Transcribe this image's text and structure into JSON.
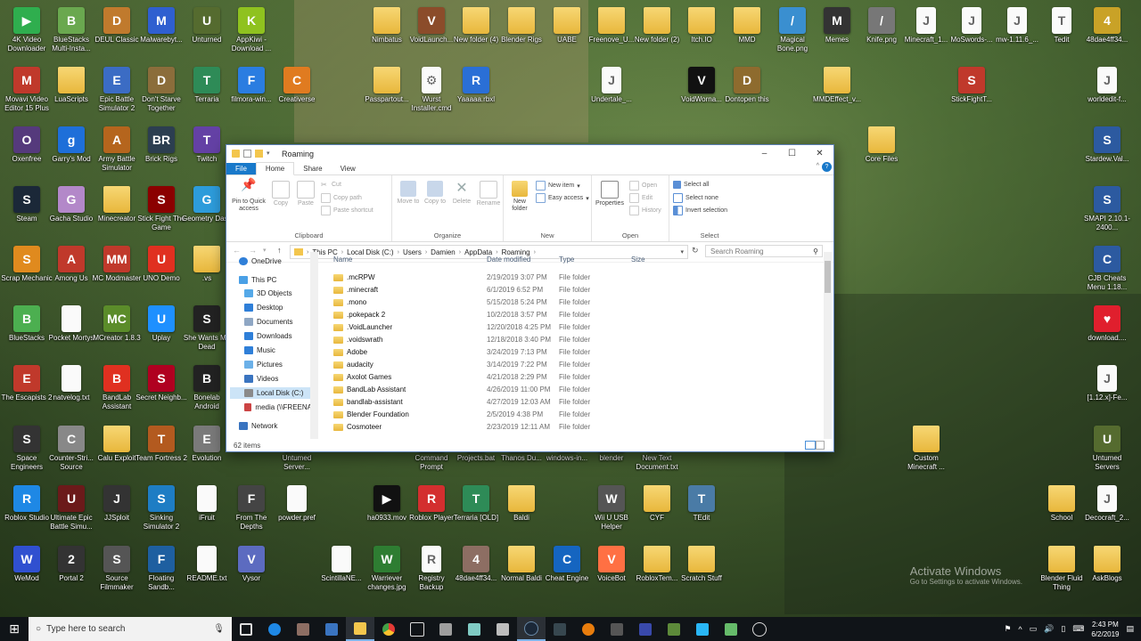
{
  "desktop_icons": [
    {
      "label": "4K Video Downloader",
      "color": "#2fae4e",
      "glyph": "▶"
    },
    {
      "label": "BlueStacks Multi-Insta...",
      "color": "#6aa84f",
      "glyph": "B"
    },
    {
      "label": "DEUL Classic",
      "color": "#c07a2d",
      "glyph": "D"
    },
    {
      "label": "Malwarebyt...",
      "color": "#2f5fd0",
      "glyph": "M"
    },
    {
      "label": "Unturned",
      "color": "#556b2f",
      "glyph": "U"
    },
    {
      "label": "AppKiwi - Download ...",
      "color": "#8fc21f",
      "glyph": "K"
    },
    {
      "label": "Nimbatus",
      "color": "folder",
      "glyph": ""
    },
    {
      "label": "VoidLaunch...",
      "color": "#8b4c2a",
      "glyph": "V"
    },
    {
      "label": "New folder (4)",
      "color": "folder",
      "glyph": ""
    },
    {
      "label": "Blender Rigs",
      "color": "folder",
      "glyph": ""
    },
    {
      "label": "UABE",
      "color": "folder",
      "glyph": ""
    },
    {
      "label": "Freenove_U...",
      "color": "folder",
      "glyph": ""
    },
    {
      "label": "New folder (2)",
      "color": "folder",
      "glyph": ""
    },
    {
      "label": "Itch.IO",
      "color": "folder",
      "glyph": ""
    },
    {
      "label": "MMD",
      "color": "folder",
      "glyph": ""
    },
    {
      "label": "Magical Bone.png",
      "color": "#3a8fd0",
      "glyph": "/"
    },
    {
      "label": "Memes",
      "color": "#333",
      "glyph": "M"
    },
    {
      "label": "Knife.png",
      "color": "#777",
      "glyph": "/"
    },
    {
      "label": "Minecraft_1...",
      "color": "doc",
      "glyph": "J"
    },
    {
      "label": "MoSwords-...",
      "color": "doc",
      "glyph": "J"
    },
    {
      "label": "mw-1.11.6_...",
      "color": "doc",
      "glyph": "J"
    },
    {
      "label": "Tedit",
      "color": "doc",
      "glyph": "T"
    },
    {
      "label": "48dae4ff34...",
      "color": "#c9a227",
      "glyph": "4"
    },
    {
      "label": "Movavi Video Editor 15 Plus",
      "color": "#c0392b",
      "glyph": "M"
    },
    {
      "label": "LuaScripts",
      "color": "folder",
      "glyph": ""
    },
    {
      "label": "Epic Battle Simulator 2",
      "color": "#3b6cc4",
      "glyph": "E"
    },
    {
      "label": "Don't Starve Together",
      "color": "#8b6d3b",
      "glyph": "D"
    },
    {
      "label": "Terraria",
      "color": "#2e8b57",
      "glyph": "T"
    },
    {
      "label": "filmora-win...",
      "color": "#2a7de1",
      "glyph": "F"
    },
    {
      "label": "Creativerse",
      "color": "#e07b20",
      "glyph": "C"
    },
    {
      "label": "Passpartout...",
      "color": "folder",
      "glyph": ""
    },
    {
      "label": "Wurst Installer.cmd",
      "color": "doc",
      "glyph": "⚙"
    },
    {
      "label": "Yaaaaa.rbxl",
      "color": "#2a6fd6",
      "glyph": "R"
    },
    {
      "label": "Undertale_...",
      "color": "doc",
      "glyph": "J"
    },
    {
      "label": "VoidWorna...",
      "color": "#111",
      "glyph": "V"
    },
    {
      "label": "Dontopen this",
      "color": "#8e6b2e",
      "glyph": "D"
    },
    {
      "label": "MMDEffect_v...",
      "color": "folder",
      "glyph": ""
    },
    {
      "label": "StickFightT...",
      "color": "#c0392b",
      "glyph": "S"
    },
    {
      "label": "worldedit-f...",
      "color": "doc",
      "glyph": "J"
    },
    {
      "label": "Core Files",
      "color": "folder",
      "glyph": ""
    },
    {
      "label": "Stardew.Val...",
      "color": "#2c5aa0",
      "glyph": "S"
    },
    {
      "label": "SMAPI 2.10.1-2400...",
      "color": "#2c5aa0",
      "glyph": "S"
    },
    {
      "label": "CJB Cheats Menu 1.18...",
      "color": "#2c5aa0",
      "glyph": "C"
    },
    {
      "label": "download....",
      "color": "#e01f2d",
      "glyph": "♥"
    },
    {
      "label": "[1.12.x]-Fe...",
      "color": "doc",
      "glyph": "J"
    },
    {
      "label": "Custom Minecraft ...",
      "color": "folder",
      "glyph": ""
    },
    {
      "label": "Untumed Servers",
      "color": "#556b2f",
      "glyph": "U"
    },
    {
      "label": "Decocraft_2...",
      "color": "doc",
      "glyph": "J"
    },
    {
      "label": "School",
      "color": "folder",
      "glyph": ""
    },
    {
      "label": "Blender Fluid Thing",
      "color": "folder",
      "glyph": ""
    },
    {
      "label": "AskBlogs",
      "color": "folder",
      "glyph": ""
    },
    {
      "label": "Oxenfree",
      "color": "#553a7c",
      "glyph": "O"
    },
    {
      "label": "Garry's Mod",
      "color": "#1e6fd9",
      "glyph": "g"
    },
    {
      "label": "Army Battle Simulator",
      "color": "#b5651d",
      "glyph": "A"
    },
    {
      "label": "Brick Rigs",
      "color": "#2c3e50",
      "glyph": "BR"
    },
    {
      "label": "Twitch",
      "color": "#6441a5",
      "glyph": "T"
    },
    {
      "label": "Steam",
      "color": "#1b2838",
      "glyph": "S"
    },
    {
      "label": "Gacha Studio",
      "color": "#b388c9",
      "glyph": "G"
    },
    {
      "label": "Minecreator",
      "color": "folder",
      "glyph": ""
    },
    {
      "label": "Stick Fight The Game",
      "color": "#8b0000",
      "glyph": "S"
    },
    {
      "label": "Geometry Dash",
      "color": "#2d9cdb",
      "glyph": "G"
    },
    {
      "label": "Scrap Mechanic",
      "color": "#e08a1e",
      "glyph": "S"
    },
    {
      "label": "Among Us",
      "color": "#c0392b",
      "glyph": "A"
    },
    {
      "label": "MC Modmaster",
      "color": "#c0392b",
      "glyph": "MM"
    },
    {
      "label": "UNO Demo",
      "color": "#e03020",
      "glyph": "U"
    },
    {
      "label": ".vs",
      "color": "folder",
      "glyph": ""
    },
    {
      "label": "BlueStacks",
      "color": "#4caf50",
      "glyph": "B"
    },
    {
      "label": "Pocket Mortys",
      "color": "doc",
      "glyph": ""
    },
    {
      "label": "MCreator 1.8.3",
      "color": "#5b8c2a",
      "glyph": "MC"
    },
    {
      "label": "Uplay",
      "color": "#1e90ff",
      "glyph": "U"
    },
    {
      "label": "She Wants Me Dead",
      "color": "#222",
      "glyph": "S"
    },
    {
      "label": "The Escapists 2",
      "color": "#c0392b",
      "glyph": "E"
    },
    {
      "label": "natvelog.txt",
      "color": "doc",
      "glyph": ""
    },
    {
      "label": "BandLab Assistant",
      "color": "#e03020",
      "glyph": "B"
    },
    {
      "label": "Secret Neighb...",
      "color": "#b00020",
      "glyph": "S"
    },
    {
      "label": "Bonelab Android",
      "color": "#222",
      "glyph": "B"
    },
    {
      "label": "Space Engineers",
      "color": "#333",
      "glyph": "S"
    },
    {
      "label": "Counter-Stri... Source",
      "color": "#888",
      "glyph": "C"
    },
    {
      "label": "Calu Exploit",
      "color": "folder",
      "glyph": ""
    },
    {
      "label": "Team Fortress 2",
      "color": "#b35a1f",
      "glyph": "T"
    },
    {
      "label": "Evolution",
      "color": "#7a7a7a",
      "glyph": "E"
    },
    {
      "label": "Untumed Server...",
      "color": "#556b2f",
      "glyph": "U"
    },
    {
      "label": "Command Prompt",
      "color": "#111",
      "glyph": ">"
    },
    {
      "label": "Projects.bat",
      "color": "doc",
      "glyph": ""
    },
    {
      "label": "Thanos Du...",
      "color": "#6a4c93",
      "glyph": "T"
    },
    {
      "label": "windows-in...",
      "color": "doc",
      "glyph": ""
    },
    {
      "label": "blender",
      "color": "#e87d0d",
      "glyph": "b"
    },
    {
      "label": "New Text Document.txt",
      "color": "doc",
      "glyph": ""
    },
    {
      "label": "Roblox Studio",
      "color": "#1e88e5",
      "glyph": "R"
    },
    {
      "label": "Ultimate Epic Battle Simu...",
      "color": "#6b1a1a",
      "glyph": "U"
    },
    {
      "label": "JJSploit",
      "color": "#333",
      "glyph": "J"
    },
    {
      "label": "Sinking Simulator 2",
      "color": "#1e7dc4",
      "glyph": "S"
    },
    {
      "label": "iFruit",
      "color": "doc",
      "glyph": ""
    },
    {
      "label": "From The Depths",
      "color": "#444",
      "glyph": "F"
    },
    {
      "label": "powder.pref",
      "color": "doc",
      "glyph": ""
    },
    {
      "label": "ha0933.mov",
      "color": "#111",
      "glyph": "▶"
    },
    {
      "label": "Roblox Player",
      "color": "#d32f2f",
      "glyph": "R"
    },
    {
      "label": "Terraria [OLD]",
      "color": "#2e8b57",
      "glyph": "T"
    },
    {
      "label": "Baldi",
      "color": "folder",
      "glyph": ""
    },
    {
      "label": "Wii U USB Helper",
      "color": "#555",
      "glyph": "W"
    },
    {
      "label": "CYF",
      "color": "folder",
      "glyph": ""
    },
    {
      "label": "TEdit",
      "color": "#4a7ba6",
      "glyph": "T"
    },
    {
      "label": "WeMod",
      "color": "#3050d0",
      "glyph": "W"
    },
    {
      "label": "Portal 2",
      "color": "#333",
      "glyph": "2"
    },
    {
      "label": "Source Filmmaker",
      "color": "#555",
      "glyph": "S"
    },
    {
      "label": "Floating Sandb...",
      "color": "#1e5fa0",
      "glyph": "F"
    },
    {
      "label": "README.txt",
      "color": "doc",
      "glyph": ""
    },
    {
      "label": "Vysor",
      "color": "#5c6bc0",
      "glyph": "V"
    },
    {
      "label": "ScintillaNE...",
      "color": "doc",
      "glyph": ""
    },
    {
      "label": "Warriever changes.jpg",
      "color": "#2e7d32",
      "glyph": "W"
    },
    {
      "label": "Registry Backup",
      "color": "doc",
      "glyph": "R"
    },
    {
      "label": "48dae4ff34...",
      "color": "#8d6e63",
      "glyph": "4"
    },
    {
      "label": "Normal Baldi",
      "color": "folder",
      "glyph": ""
    },
    {
      "label": "Cheat Engine",
      "color": "#1565c0",
      "glyph": "C"
    },
    {
      "label": "VoiceBot",
      "color": "#ff7043",
      "glyph": "V"
    },
    {
      "label": "RobloxTem...",
      "color": "folder",
      "glyph": ""
    },
    {
      "label": "Scratch Stuff",
      "color": "folder",
      "glyph": ""
    }
  ],
  "explorer": {
    "title": "Roaming",
    "controls": {
      "minimize": "–",
      "maximize": "☐",
      "close": "✕"
    },
    "tabs": [
      "File",
      "Home",
      "Share",
      "View"
    ],
    "ribbon": {
      "clipboard": {
        "group": "Clipboard",
        "pin": "Pin to Quick access",
        "copy": "Copy",
        "paste": "Paste",
        "cut": "Cut",
        "copy_path": "Copy path",
        "paste_shortcut": "Paste shortcut"
      },
      "organize": {
        "group": "Organize",
        "move_to": "Move to",
        "copy_to": "Copy to",
        "delete": "Delete",
        "rename": "Rename"
      },
      "new": {
        "group": "New",
        "new_folder": "New folder",
        "new_item": "New item",
        "easy_access": "Easy access"
      },
      "open": {
        "group": "Open",
        "properties": "Properties",
        "open": "Open",
        "edit": "Edit",
        "history": "History"
      },
      "select": {
        "group": "Select",
        "select_all": "Select all",
        "select_none": "Select none",
        "invert": "Invert selection"
      }
    },
    "breadcrumb": [
      "This PC",
      "Local Disk (C:)",
      "Users",
      "Damien",
      "AppData",
      "Roaming"
    ],
    "search_placeholder": "Search Roaming",
    "nav_pane": [
      "OneDrive",
      "This PC",
      "3D Objects",
      "Desktop",
      "Documents",
      "Downloads",
      "Music",
      "Pictures",
      "Videos",
      "Local Disk (C:)",
      "media (\\\\FREENA",
      "Network"
    ],
    "columns": {
      "name": "Name",
      "date": "Date modified",
      "type": "Type",
      "size": "Size"
    },
    "files": [
      {
        "name": ".mcRPW",
        "date": "2/19/2019 3:07 PM",
        "type": "File folder"
      },
      {
        "name": ".minecraft",
        "date": "6/1/2019 6:52 PM",
        "type": "File folder"
      },
      {
        "name": ".mono",
        "date": "5/15/2018 5:24 PM",
        "type": "File folder"
      },
      {
        "name": ".pokepack 2",
        "date": "10/2/2018 3:57 PM",
        "type": "File folder"
      },
      {
        "name": ".VoidLauncher",
        "date": "12/20/2018 4:25 PM",
        "type": "File folder"
      },
      {
        "name": ".voidswrath",
        "date": "12/18/2018 3:40 PM",
        "type": "File folder"
      },
      {
        "name": "Adobe",
        "date": "3/24/2019 7:13 PM",
        "type": "File folder"
      },
      {
        "name": "audacity",
        "date": "3/14/2019 7:22 PM",
        "type": "File folder"
      },
      {
        "name": "Axolot Games",
        "date": "4/21/2018 2:29 PM",
        "type": "File folder"
      },
      {
        "name": "BandLab Assistant",
        "date": "4/26/2019 11:00 PM",
        "type": "File folder"
      },
      {
        "name": "bandlab-assistant",
        "date": "4/27/2019 12:03 AM",
        "type": "File folder"
      },
      {
        "name": "Blender Foundation",
        "date": "2/5/2019 4:38 PM",
        "type": "File folder"
      },
      {
        "name": "Cosmoteer",
        "date": "2/23/2019 12:11 AM",
        "type": "File folder"
      }
    ],
    "status": "62 items"
  },
  "taskbar": {
    "search_placeholder": "Type here to search",
    "time": "2:43 PM",
    "date": "6/2/2019"
  },
  "watermark": {
    "line1": "Activate Windows",
    "line2": "Go to Settings to activate Windows."
  }
}
